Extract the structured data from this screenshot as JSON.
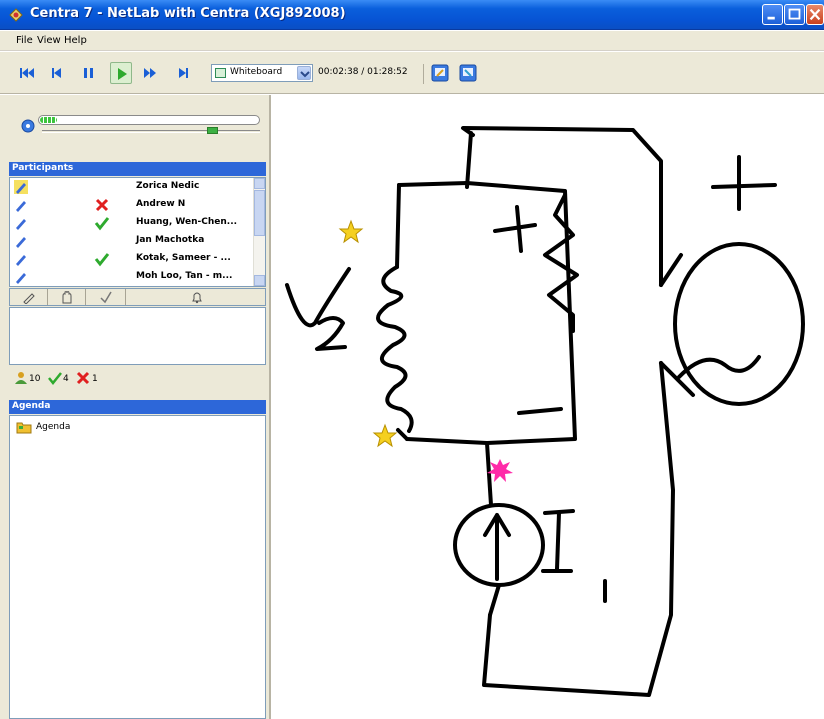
{
  "window": {
    "title": "Centra 7 - NetLab with Centra (XGJ892008)"
  },
  "menu": {
    "file": "File",
    "view": "View",
    "help": "Help"
  },
  "toolbar": {
    "view_select": "Whiteboard",
    "time": "00:02:38 / 01:28:52",
    "play_icon": "play-icon",
    "colors": {
      "accent": "#2d67d9",
      "play": "#2eaa2e",
      "nav": "#1a5fd6"
    }
  },
  "playback": {
    "progress": 0.08,
    "volume": 0.78
  },
  "participants": {
    "header": "Participants",
    "rows": [
      {
        "name": "Zorica Nedic",
        "status": "none",
        "icon": "pen-highlight-icon"
      },
      {
        "name": "Andrew N",
        "status": "no",
        "icon": "pen-icon"
      },
      {
        "name": "Huang, Wen-Chen...",
        "status": "yes",
        "icon": "pen-icon"
      },
      {
        "name": "Jan Machotka",
        "status": "none",
        "icon": "pen-icon"
      },
      {
        "name": "Kotak, Sameer - ...",
        "status": "yes",
        "icon": "pen-icon"
      },
      {
        "name": "Moh Loo, Tan - m...",
        "status": "none",
        "icon": "pen-icon"
      }
    ],
    "counts": {
      "total": "10",
      "yes": "4",
      "no": "1"
    }
  },
  "agenda": {
    "header": "Agenda",
    "item": "Agenda"
  },
  "whiteboard": {
    "labels": {
      "plus_inner": "+",
      "plus_outer": "+",
      "minus": "−",
      "v2": "V2",
      "i1": "I1"
    }
  }
}
